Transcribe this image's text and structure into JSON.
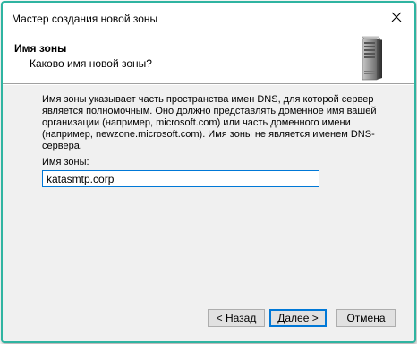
{
  "window": {
    "title": "Мастер создания новой зоны",
    "close_glyph": "✕",
    "accent": "#2fb4a1"
  },
  "header": {
    "title": "Имя зоны",
    "subtitle": "Каково имя новой зоны?",
    "icon": "server-icon"
  },
  "body": {
    "description": "Имя зоны указывает часть пространства имен DNS, для которой сервер является полномочным. Оно должно представлять доменное имя вашей организации (например, microsoft.com) или часть доменного имени (например, newzone.microsoft.com). Имя зоны не является именем DNS-сервера.",
    "zone_label": "Имя зоны:",
    "zone_value": "katasmtp.corp"
  },
  "buttons": {
    "back": "< Назад",
    "next": "Далее >",
    "cancel": "Отмена"
  }
}
